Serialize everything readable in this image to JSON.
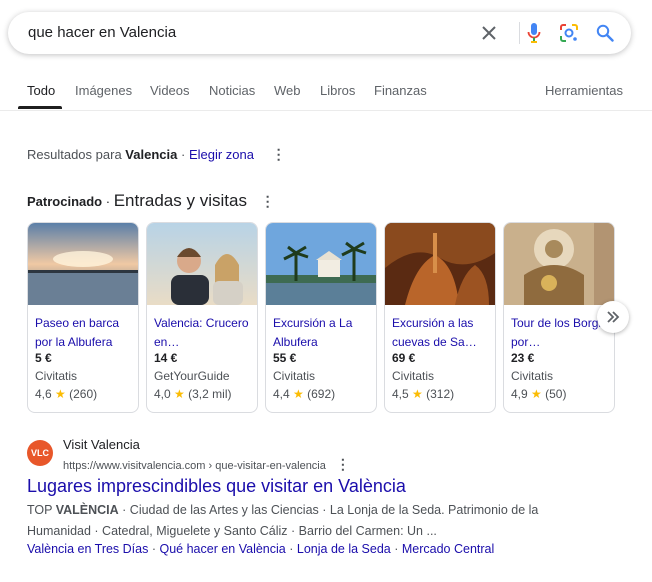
{
  "search": {
    "query": "que hacer en Valencia"
  },
  "tabs": [
    "Todo",
    "Imágenes",
    "Videos",
    "Noticias",
    "Web",
    "Libros",
    "Finanzas"
  ],
  "tools_label": "Herramientas",
  "region": {
    "prefix": "Resultados para",
    "place": "Valencia",
    "sep": "·",
    "change_label": "Elegir zona"
  },
  "sponsored": {
    "label": "Patrocinado",
    "sep": "·",
    "title": "Entradas y visitas"
  },
  "cards": [
    {
      "title": "Paseo en barca por la Albufera",
      "price": "5 €",
      "vendor": "Civitatis",
      "rating": "4,6",
      "reviews": "(260)"
    },
    {
      "title": "Valencia: Crucero en…",
      "price": "14 €",
      "vendor": "GetYourGuide",
      "rating": "4,0",
      "reviews": "(3,2 mil)"
    },
    {
      "title": "Excursión a La Albufera",
      "price": "55 €",
      "vendor": "Civitatis",
      "rating": "4,4",
      "reviews": "(692)"
    },
    {
      "title": "Excursión a las cuevas de Sa…",
      "price": "69 €",
      "vendor": "Civitatis",
      "rating": "4,5",
      "reviews": "(312)"
    },
    {
      "title": "Tour de los Borgia por…",
      "price": "23 €",
      "vendor": "Civitatis",
      "rating": "4,9",
      "reviews": "(50)"
    }
  ],
  "result": {
    "favicon_text": "VLC",
    "site_name": "Visit Valencia",
    "url": "https://www.visitvalencia.com › que-visitar-en-valencia",
    "title": "Lugares imprescindibles que visitar en València",
    "snippet_prefix": "TOP ",
    "snippet_bold": "VALÈNCIA",
    "snippet_rest": " · Ciudad de las Artes y las Ciencias · La Lonja de la Seda. Patrimonio de la Humanidad · Catedral, Miguelete y Santo Cáliz · Barrio del Carmen: Un ...",
    "sitelinks": [
      "València en Tres Días",
      "Qué hacer en València",
      "Lonja de la Seda",
      "Mercado Central"
    ],
    "sitelink_sep": "·"
  },
  "colors": {
    "link": "#1a0dab",
    "star": "#fbbc04",
    "favicon": "#e8572a"
  },
  "icons": [
    "clear-icon",
    "mic-icon",
    "lens-icon",
    "search-icon",
    "more-vert-icon",
    "chevron-right-icon"
  ]
}
